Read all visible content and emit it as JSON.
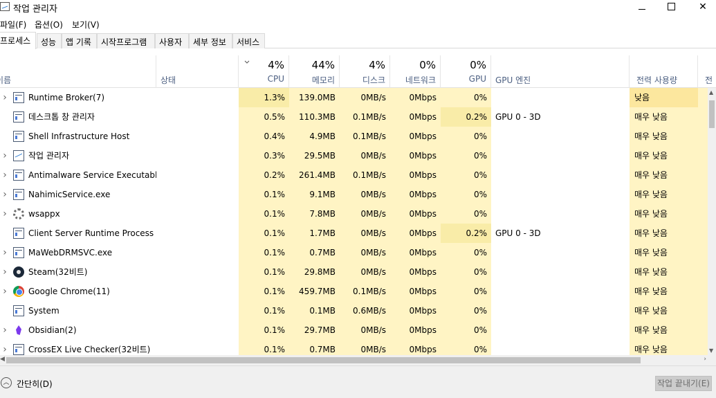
{
  "window": {
    "title": "작업 관리자"
  },
  "menu": [
    "파일(F)",
    "옵션(O)",
    "보기(V)"
  ],
  "tabs": [
    "프로세스",
    "성능",
    "앱 기록",
    "시작프로그램",
    "사용자",
    "세부 정보",
    "서비스"
  ],
  "columns": {
    "name": "이름",
    "status": "상태",
    "cpu": {
      "pct": "4%",
      "label": "CPU"
    },
    "memory": {
      "pct": "44%",
      "label": "메모리"
    },
    "disk": {
      "pct": "4%",
      "label": "디스크"
    },
    "network": {
      "pct": "0%",
      "label": "네트워크"
    },
    "gpu": {
      "pct": "0%",
      "label": "GPU"
    },
    "gpu_engine": "GPU 엔진",
    "power": "전력 사용량",
    "power_trend": "전력"
  },
  "processes": [
    {
      "name": "Runtime Broker(7)",
      "icon": "window-icon",
      "expand": true,
      "cpu": "1.3%",
      "mem": "139.0MB",
      "disk": "0MB/s",
      "net": "0Mbps",
      "gpu": "0%",
      "gpu_engine": "",
      "power": "낮음"
    },
    {
      "name": "데스크톱 창 관리자",
      "icon": "window-icon",
      "expand": false,
      "cpu": "0.5%",
      "mem": "110.3MB",
      "disk": "0.1MB/s",
      "net": "0Mbps",
      "gpu": "0.2%",
      "gpu_engine": "GPU 0 - 3D",
      "power": "매우 낮음"
    },
    {
      "name": "Shell Infrastructure Host",
      "icon": "window-icon",
      "expand": false,
      "cpu": "0.4%",
      "mem": "4.9MB",
      "disk": "0.1MB/s",
      "net": "0Mbps",
      "gpu": "0%",
      "gpu_engine": "",
      "power": "매우 낮음"
    },
    {
      "name": "작업 관리자",
      "icon": "task-manager-icon",
      "expand": true,
      "cpu": "0.3%",
      "mem": "29.5MB",
      "disk": "0MB/s",
      "net": "0Mbps",
      "gpu": "0%",
      "gpu_engine": "",
      "power": "매우 낮음"
    },
    {
      "name": "Antimalware Service Executable",
      "icon": "window-icon",
      "expand": true,
      "cpu": "0.2%",
      "mem": "261.4MB",
      "disk": "0.1MB/s",
      "net": "0Mbps",
      "gpu": "0%",
      "gpu_engine": "",
      "power": "매우 낮음"
    },
    {
      "name": "NahimicService.exe",
      "icon": "window-icon",
      "expand": true,
      "cpu": "0.1%",
      "mem": "9.1MB",
      "disk": "0MB/s",
      "net": "0Mbps",
      "gpu": "0%",
      "gpu_engine": "",
      "power": "매우 낮음"
    },
    {
      "name": "wsappx",
      "icon": "gear-icon",
      "expand": true,
      "cpu": "0.1%",
      "mem": "7.8MB",
      "disk": "0MB/s",
      "net": "0Mbps",
      "gpu": "0%",
      "gpu_engine": "",
      "power": "매우 낮음"
    },
    {
      "name": "Client Server Runtime Process",
      "icon": "window-icon",
      "expand": false,
      "cpu": "0.1%",
      "mem": "1.7MB",
      "disk": "0MB/s",
      "net": "0Mbps",
      "gpu": "0.2%",
      "gpu_engine": "GPU 0 - 3D",
      "power": "매우 낮음"
    },
    {
      "name": "MaWebDRMSVC.exe",
      "icon": "window-icon",
      "expand": true,
      "cpu": "0.1%",
      "mem": "0.7MB",
      "disk": "0MB/s",
      "net": "0Mbps",
      "gpu": "0%",
      "gpu_engine": "",
      "power": "매우 낮음"
    },
    {
      "name": "Steam(32비트)",
      "icon": "steam-icon",
      "expand": true,
      "cpu": "0.1%",
      "mem": "29.8MB",
      "disk": "0MB/s",
      "net": "0Mbps",
      "gpu": "0%",
      "gpu_engine": "",
      "power": "매우 낮음"
    },
    {
      "name": "Google Chrome(11)",
      "icon": "chrome-icon",
      "expand": true,
      "cpu": "0.1%",
      "mem": "459.7MB",
      "disk": "0.1MB/s",
      "net": "0Mbps",
      "gpu": "0%",
      "gpu_engine": "",
      "power": "매우 낮음"
    },
    {
      "name": "System",
      "icon": "window-icon",
      "expand": false,
      "cpu": "0.1%",
      "mem": "0.1MB",
      "disk": "0.6MB/s",
      "net": "0Mbps",
      "gpu": "0%",
      "gpu_engine": "",
      "power": "매우 낮음"
    },
    {
      "name": "Obsidian(2)",
      "icon": "obsidian-icon",
      "expand": true,
      "cpu": "0.1%",
      "mem": "29.7MB",
      "disk": "0MB/s",
      "net": "0Mbps",
      "gpu": "0%",
      "gpu_engine": "",
      "power": "매우 낮음"
    },
    {
      "name": "CrossEX Live Checker(32비트)",
      "icon": "window-icon",
      "expand": true,
      "cpu": "0.1%",
      "mem": "0.7MB",
      "disk": "0MB/s",
      "net": "0Mbps",
      "gpu": "0%",
      "gpu_engine": "",
      "power": "매우 낮음"
    }
  ],
  "footer": {
    "fewer_details": "간단히(D)",
    "end_task": "작업 끝내기(E)"
  }
}
